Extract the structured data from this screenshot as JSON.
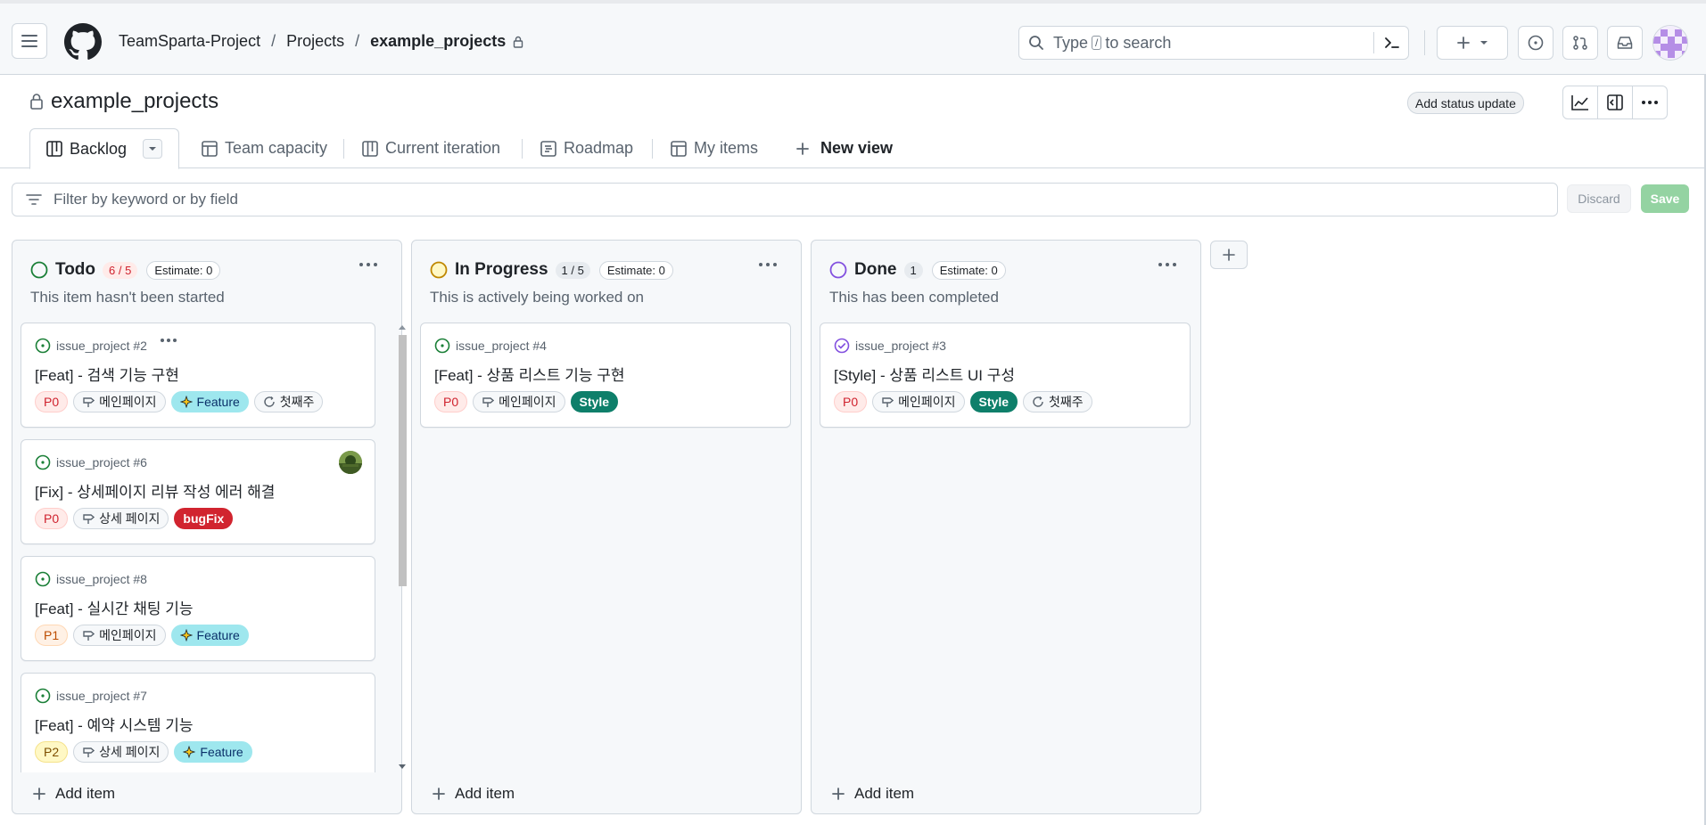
{
  "header": {
    "breadcrumb": [
      "TeamSparta-Project",
      "Projects",
      "example_projects"
    ],
    "search_prefix": "Type",
    "search_key": "/",
    "search_suffix": "to search"
  },
  "project": {
    "title": "example_projects",
    "status_update_label": "Add status update"
  },
  "tabs": [
    {
      "label": "Backlog",
      "icon": "board-icon"
    },
    {
      "label": "Team capacity",
      "icon": "table-icon"
    },
    {
      "label": "Current iteration",
      "icon": "board-icon"
    },
    {
      "label": "Roadmap",
      "icon": "roadmap-icon"
    },
    {
      "label": "My items",
      "icon": "table-icon"
    },
    {
      "label": "New view",
      "icon": "plus-icon"
    }
  ],
  "filter": {
    "placeholder": "Filter by keyword or by field",
    "discard_label": "Discard",
    "save_label": "Save"
  },
  "columns": [
    {
      "name": "Todo",
      "count": "6 / 5",
      "estimate": "Estimate: 0",
      "description": "This item hasn't been started",
      "status_color": "#1a7f37",
      "add_label": "Add item",
      "cards": [
        {
          "ref": "issue_project #2",
          "title": "[Feat] - 검색 기능 구현",
          "labels": [
            "P0",
            "메인페이지",
            "Feature",
            "첫째주"
          ]
        },
        {
          "ref": "issue_project #6",
          "title": "[Fix] - 상세페이지 리뷰 작성 에러 해결",
          "labels": [
            "P0",
            "상세 페이지",
            "bugFix"
          ]
        },
        {
          "ref": "issue_project #8",
          "title": "[Feat] - 실시간 채팅 기능",
          "labels": [
            "P1",
            "메인페이지",
            "Feature"
          ]
        },
        {
          "ref": "issue_project #7",
          "title": "[Feat] - 예약 시스템 기능",
          "labels": [
            "P2",
            "상세 페이지",
            "Feature"
          ]
        }
      ]
    },
    {
      "name": "In Progress",
      "count": "1 / 5",
      "estimate": "Estimate: 0",
      "description": "This is actively being worked on",
      "status_color": "#bf8700",
      "add_label": "Add item",
      "cards": [
        {
          "ref": "issue_project #4",
          "title": "[Feat] - 상품 리스트 기능 구현",
          "labels": [
            "P0",
            "메인페이지",
            "Style"
          ]
        }
      ]
    },
    {
      "name": "Done",
      "count": "1",
      "estimate": "Estimate: 0",
      "description": "This has been completed",
      "status_color": "#8250df",
      "add_label": "Add item",
      "cards": [
        {
          "ref": "issue_project #3",
          "title": "[Style] - 상품 리스트 UI 구성",
          "labels": [
            "P0",
            "메인페이지",
            "Style",
            "첫째주"
          ]
        }
      ]
    }
  ]
}
